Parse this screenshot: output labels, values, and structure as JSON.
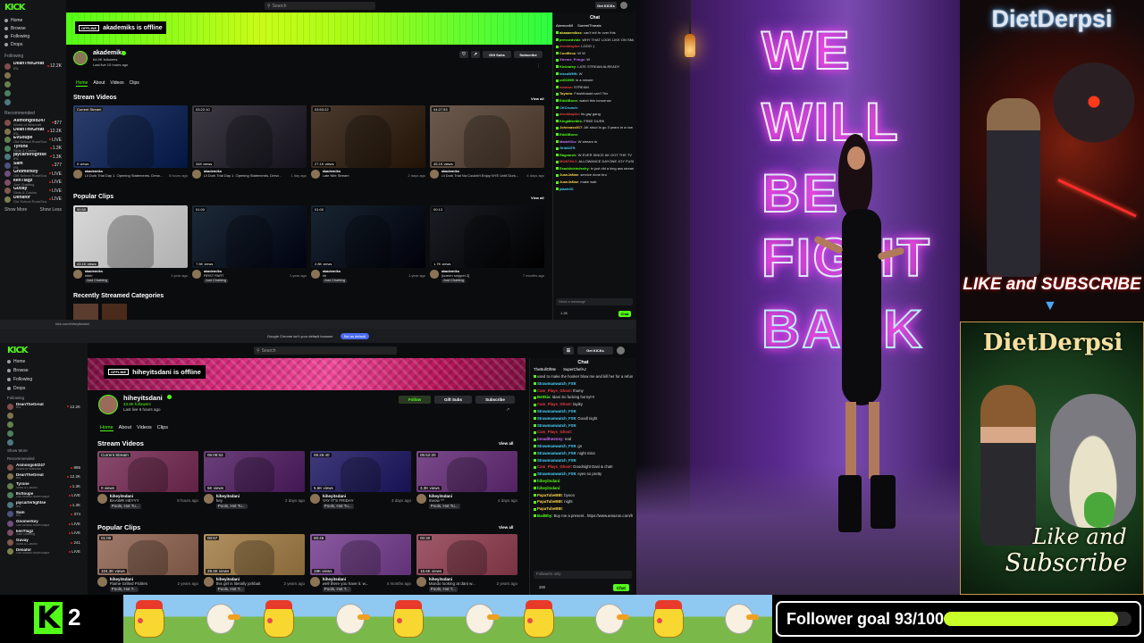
{
  "top": {
    "logo": "KICK",
    "nav": [
      "Home",
      "Browse",
      "Following",
      "Drops"
    ],
    "search_placeholder": "Search",
    "following_label": "Following",
    "recommended_label": "Recommended",
    "show_more": "Show More",
    "show_less": "Show Less",
    "followed": [
      {
        "name": "DeanTheGreat",
        "sub": "IRL",
        "count": "12.2K",
        "live": true
      },
      {
        "name": "",
        "sub": "",
        "count": "",
        "live": false
      },
      {
        "name": "",
        "sub": "",
        "count": "",
        "live": false
      },
      {
        "name": "",
        "sub": "",
        "count": "",
        "live": false
      },
      {
        "name": "",
        "sub": "",
        "count": "",
        "live": false
      }
    ],
    "recommended": [
      {
        "name": "Asmongold247",
        "sub": "World of Warcraft",
        "count": "877"
      },
      {
        "name": "DeanTheGreat",
        "sub": "IRL",
        "count": "12.2K"
      },
      {
        "name": "EvSoupe",
        "sub": "Old School RuneScape",
        "count": "LIVE"
      },
      {
        "name": "Tyrone",
        "sub": "Slots & Casino",
        "count": "1.3K"
      },
      {
        "name": "jaycarterlightse",
        "sub": "IRL",
        "count": "1.3K"
      },
      {
        "name": "Sam",
        "sub": "IRL",
        "count": "377"
      },
      {
        "name": "Gnomerkey",
        "sub": "Old School RuneScape",
        "count": "LIVE"
      },
      {
        "name": "kenTlagz",
        "sub": "Just Chatting",
        "count": "LIVE"
      },
      {
        "name": "Guvay",
        "sub": "Slots & Casino",
        "count": "LIVE"
      },
      {
        "name": "Denafor",
        "sub": "Old School RuneScape",
        "count": "LIVE"
      }
    ],
    "offline_tag": "OFFLINE",
    "offline_text": "akademiks is offline",
    "channel_name": "akademiks",
    "followers": "64.9K followers",
    "last_live": "Last live 10 hours ago",
    "gift_subs": "Gift Subs",
    "subscribe": "Subscribe",
    "tabs": [
      "Home",
      "About",
      "Videos",
      "Clips"
    ],
    "videos_title": "Stream Videos",
    "clips_title": "Popular Clips",
    "categories_title": "Recently Streamed Categories",
    "view_all": "View all",
    "videos": [
      {
        "badge": "Current Stream",
        "views": "0 views",
        "channel": "akademiks",
        "title": "Lil Durk Trial Day 1. Opening Statements. Drew...",
        "age": "5 hours ago",
        "color": "#2c3e6b"
      },
      {
        "badge": "03:22:10",
        "views": "34K views",
        "channel": "akademiks",
        "title": "Lil Durk Trial Day 1. Opening Statements. Drew...",
        "age": "1 day ago",
        "color": "#3d3a44"
      },
      {
        "badge": "03:53:22",
        "views": "27.1K views",
        "channel": "akademiks",
        "title": "Late Nite Stream",
        "age": "2 days ago",
        "color": "#4a3b2e"
      },
      {
        "badge": "04:27:53",
        "views": "45.1K views",
        "channel": "akademiks",
        "title": "Lil Durk Trial Na Couldn't Enjoy NYE Until Durk...",
        "age": "4 days ago",
        "color": "#6b5a4d"
      }
    ],
    "clips": [
      {
        "badge": "00:55",
        "views": "43.1K views",
        "channel": "akademiks",
        "title": "bbbb",
        "age": "1 year ago",
        "tag": "Just Chatting",
        "color": "#d8d8d8"
      },
      {
        "badge": "01:00",
        "views": "7.5K views",
        "channel": "akademiks",
        "title": "FIRST PART",
        "age": "1 year ago",
        "tag": "Just Chatting",
        "color": "#1d2a38"
      },
      {
        "badge": "01:00",
        "views": "2.8K views",
        "channel": "akademiks",
        "title": "bb",
        "age": "1 year ago",
        "tag": "Just Chatting",
        "color": "#182532"
      },
      {
        "badge": "00:13",
        "views": "1.7K views",
        "channel": "akademiks",
        "title": "[screen snippet 2]",
        "age": "7 months ago",
        "tag": "Just Chatting",
        "color": "#1b1d25"
      }
    ],
    "chat_title": "Chat",
    "chat_pinned": "Akemun69",
    "chat_pinned2": "SurreelThreats",
    "chat": [
      {
        "u": "akaaaemikss",
        "m": "can't tell frr over this",
        "c": "#e9e94a"
      },
      {
        "u": "pressedvidz",
        "m": "WHY THAT LOOK LIKE ON SMASH?!",
        "c": "#53fc18"
      },
      {
        "u": "drunktaylor",
        "m": "LOOO :)",
        "c": "#e93d3d"
      },
      {
        "u": "CoolBros",
        "m": "W W",
        "c": "#fcd24a"
      },
      {
        "u": "Xtreme_Fringe",
        "m": "W",
        "c": "#c86dfc"
      },
      {
        "u": "Kickratey",
        "m": "LATE STREAM ALREADY",
        "c": "#53fc18"
      },
      {
        "u": "lekcaWHN",
        "m": "W",
        "c": "#4ad4fc"
      },
      {
        "u": "cd01955",
        "m": "in a minute",
        "c": "#53fc18"
      },
      {
        "u": "mamas",
        "m": "STREAM",
        "c": "#e93d3d"
      },
      {
        "u": "Taytoto",
        "m": "Fmshitdadd can't Trix",
        "c": "#fcd24a"
      },
      {
        "u": "Edd4Bonn",
        "m": "watch this tomorrow",
        "c": "#53fc18"
      },
      {
        "u": "CKCrunch",
        "m": "",
        "c": "#4ad4fc"
      },
      {
        "u": "drunktaylor",
        "m": "its gay gang",
        "c": "#e93d3d"
      },
      {
        "u": "KingMikeMrk",
        "m": "FREE DURK",
        "c": "#53fc18"
      },
      {
        "u": "Johnnass917",
        "m": "AK shud to go 3 years in a row of day in a",
        "c": "#fcd24a"
      },
      {
        "u": "Edd4Bonn",
        "m": "",
        "c": "#53fc18"
      },
      {
        "u": "MadeKikz",
        "m": "W stream rk",
        "c": "#c86dfc"
      },
      {
        "u": "Grid4479",
        "m": "",
        "c": "#4ad4fc"
      },
      {
        "u": "Ragnarok",
        "m": "W EVER SINCE AK GOT THE TV",
        "c": "#53fc18"
      },
      {
        "u": "MONTHLY",
        "m": "ALLOWANCE DAYONE JOY FUSHOW DONT STREAM NO MORE AND WHEN HE DOES ITS ONLY FOR 3 HOURS SWE THE DAILY W's ARE DON'T FOR",
        "c": "#e93d3d"
      },
      {
        "u": "Esaddicktedeshy",
        "m": "tv just did a king ass stream dickhead",
        "c": "#53fc18"
      },
      {
        "u": "JuanJaNae",
        "m": "service done bro",
        "c": "#fcd24a"
      },
      {
        "u": "JuanJaNae",
        "m": "make wait",
        "c": "#fcd24a"
      },
      {
        "u": "jdash03",
        "m": "",
        "c": "#4ad4fc"
      }
    ],
    "chat_input": "Send a message",
    "chat_count": "1.2K",
    "chat_button": "Chat"
  },
  "browser": {
    "url": "kick.com/hiheyitsdani",
    "notice": "Google Chrome isn't your default browser",
    "notice_btn": "Set as default"
  },
  "bottom": {
    "logo": "KICK",
    "nav": [
      "Home",
      "Browse",
      "Following",
      "Drops"
    ],
    "search_placeholder": "Search",
    "following_label": "Following",
    "recommended_label": "Recommended",
    "show_more": "Show More",
    "followed": [
      {
        "name": "DeanTheGreat",
        "sub": "IRL",
        "count": "12.2K",
        "live": true
      },
      {
        "name": "",
        "sub": "",
        "count": "",
        "live": false
      },
      {
        "name": "",
        "sub": "",
        "count": "",
        "live": false
      },
      {
        "name": "",
        "sub": "",
        "count": "",
        "live": false
      },
      {
        "name": "",
        "sub": "",
        "count": "",
        "live": false
      }
    ],
    "recommended": [
      {
        "name": "Asmongold247",
        "sub": "World of Warcraft",
        "count": "885"
      },
      {
        "name": "DeanTheGreat",
        "sub": "IRL",
        "count": "12.2K"
      },
      {
        "name": "Tyrone",
        "sub": "Slots & Casino",
        "count": "1.3K"
      },
      {
        "name": "EvSoupe",
        "sub": "Old School RuneScape",
        "count": "LIVE"
      },
      {
        "name": "jaycarterlightse",
        "sub": "IRL",
        "count": "1.3K"
      },
      {
        "name": "Sam",
        "sub": "IRL",
        "count": "374"
      },
      {
        "name": "Gnomerkey",
        "sub": "Old School RuneScape",
        "count": "LIVE"
      },
      {
        "name": "kenTlagz",
        "sub": "Just Chatting",
        "count": "LIVE"
      },
      {
        "name": "Guvay",
        "sub": "Slots & Casino",
        "count": "241"
      },
      {
        "name": "Denafor",
        "sub": "Old School RuneScape",
        "count": "LIVE"
      }
    ],
    "offline_tag": "OFFLINE",
    "offline_text": "hiheyitsdani is offline",
    "channel_name": "hiheyitsdani",
    "followers": "33.8K followers",
    "last_live": "Last live 6 hours ago",
    "follow": "Follow",
    "gift_subs": "Gift Subs",
    "subscribe": "Subscribe",
    "get_kick": "Get KICKs",
    "tabs": [
      "Home",
      "About",
      "Videos",
      "Clips"
    ],
    "videos_title": "Stream Videos",
    "clips_title": "Popular Clips",
    "view_all": "View all",
    "videos": [
      {
        "badge": "Current Stream",
        "views": "0 views",
        "channel": "hiheyitsdani",
        "title": "BAAWR HEYYY",
        "age": "8 hours ago",
        "tag": "Pools, Hot Tu...",
        "color": "#8a4a6d"
      },
      {
        "badge": "06:08:53",
        "views": "5K views",
        "channel": "hiheyitsdani",
        "title": "hey",
        "age": "2 days ago",
        "tag": "Pools, Hot Tu...",
        "color": "#6b3f7a"
      },
      {
        "badge": "06:26:40",
        "views": "5.6K views",
        "channel": "hiheyitsdani",
        "title": "YAY IT'S FRIDAY",
        "age": "3 days ago",
        "tag": "Pools, Hot Tu...",
        "color": "#3f3a7a"
      },
      {
        "badge": "05:52:20",
        "views": "3.3K views",
        "channel": "hiheyitsdani",
        "title": "meow ^^",
        "age": "4 days ago",
        "tag": "Pools, Hot Tu...",
        "color": "#7a4a8a"
      }
    ],
    "clips": [
      {
        "badge": "01:00",
        "views": "104.3K views",
        "channel": "hiheyitsdani",
        "title": "Flame Grilled Pickles",
        "age": "2 years ago",
        "tag": "Pools, Hot T...",
        "color": "#a07a6a"
      },
      {
        "badge": "00:57",
        "views": "29.4K views",
        "channel": "hiheyitsdani",
        "title": "this girl is literally jorkbait",
        "age": "2 years ago",
        "tag": "Pools, Hot T...",
        "color": "#b09060"
      },
      {
        "badge": "00:46",
        "views": "19K views",
        "channel": "hiheyitsdani",
        "title": "well there you have it. w...",
        "age": "4 months ago",
        "tag": "Pools, Hot T...",
        "color": "#8a5aa0"
      },
      {
        "badge": "00:30",
        "views": "15.6K views",
        "channel": "hiheyitsdani",
        "title": "Mando looking at dani w...",
        "age": "2 years ago",
        "tag": "Pools, Hot T...",
        "color": "#a05a6a"
      }
    ],
    "chat_title": "Chat",
    "chat_pinned": "TheBullOfMe",
    "chat_pinned2": "SuperChefAJ",
    "chat": [
      {
        "u": "",
        "m": "used to make the hooker blow me and kill her for a refund",
        "c": "#ddd"
      },
      {
        "u": "Strawmanwatch_FS9",
        "m": "",
        "c": "#4ad4fc"
      },
      {
        "u": "Cam_Plays_Ghost",
        "m": "thomy",
        "c": "#e93d3d"
      },
      {
        "u": "Bettkia",
        "m": "Idani So fucking horny!!!!",
        "c": "#53fc18"
      },
      {
        "u": "Cam_Plays_Ghost",
        "m": "layiky",
        "c": "#e93d3d"
      },
      {
        "u": "Strawmanwatch_FS9",
        "m": "",
        "c": "#4ad4fc"
      },
      {
        "u": "Strawmanwatch_FS9",
        "m": "Goodl night",
        "c": "#4ad4fc"
      },
      {
        "u": "Strawmanwatch_FS9",
        "m": "",
        "c": "#4ad4fc"
      },
      {
        "u": "Cam_Plays_Ghost",
        "m": "",
        "c": "#e93d3d"
      },
      {
        "u": "breadthestrey",
        "m": "real",
        "c": "#c86dfc"
      },
      {
        "u": "Strawmanwatch_FS9",
        "m": "gn",
        "c": "#4ad4fc"
      },
      {
        "u": "Strawmanwatch_FS9",
        "m": "night miss",
        "c": "#4ad4fc"
      },
      {
        "u": "Strawmanwatch_FS9",
        "m": "",
        "c": "#4ad4fc"
      },
      {
        "u": "Cam_Plays_Ghost",
        "m": "Goodnight Dani & chat!",
        "c": "#e93d3d"
      },
      {
        "u": "Strawmanwatch_FS9",
        "m": "eyes so pretty",
        "c": "#4ad4fc"
      },
      {
        "u": "hiheyitsdani",
        "m": "",
        "c": "#53fc18"
      },
      {
        "u": "hiheyitsdani",
        "m": "",
        "c": "#53fc18"
      },
      {
        "u": "PapaTubeBBt",
        "m": "byooo",
        "c": "#fcd24a"
      },
      {
        "u": "PapaTubeBBt",
        "m": "night",
        "c": "#fcd24a"
      },
      {
        "u": "PapaTubeBBt",
        "m": "",
        "c": "#fcd24a"
      },
      {
        "u": "BadBby",
        "m": "Buy me a present.. https://www.amazon.com/hz/wishlist/ls/1TX",
        "c": "#53fc18"
      }
    ],
    "chat_input": "Followers only",
    "chat_count": "280",
    "chat_button": "Chat"
  },
  "stream": {
    "neon_lines": [
      "WE",
      "WILL",
      "BE",
      "FIGHT",
      "BACK"
    ]
  },
  "ads": {
    "top_title": "DietDerpsi",
    "top_cta": "LIKE and SUBSCRIBE",
    "bottom_title": "DietDerpsi",
    "bottom_cta_1": "Like and",
    "bottom_cta_2": "Subscribe"
  },
  "bar": {
    "logo_letter": "K",
    "logo_count": "2",
    "goal_label": "Follower goal 93/100",
    "goal_progress": 0.93,
    "accent": "#53fc18"
  }
}
